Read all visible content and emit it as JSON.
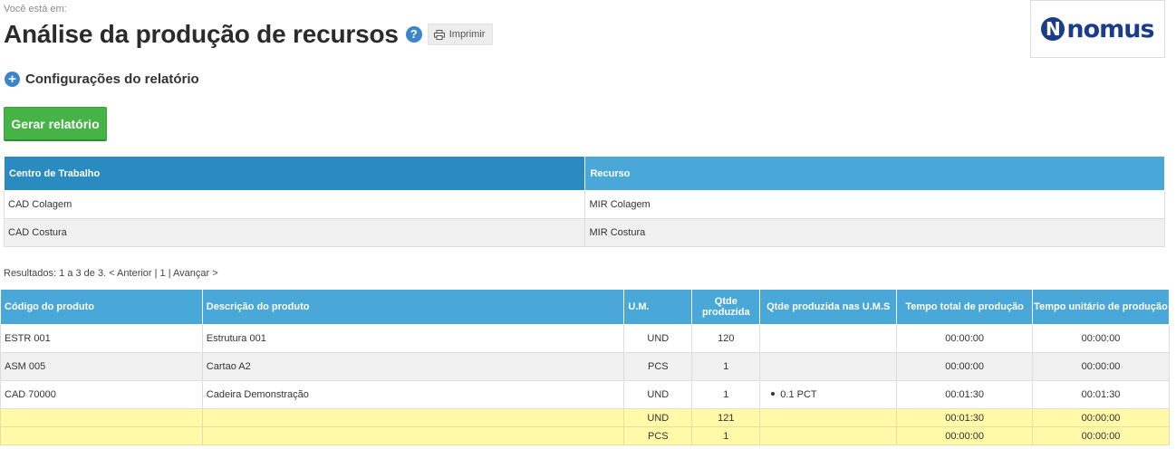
{
  "breadcrumb": "Você está em:",
  "title": "Análise da produção de recursos",
  "help_icon": "?",
  "print_label": "Imprimir",
  "logo": {
    "mark": "N",
    "text": "nomus"
  },
  "config_label": "Configurações do relatório",
  "generate_label": "Gerar relatório",
  "colors": {
    "header_blue": "#4aa8d8",
    "header_dark_blue": "#2a8bc0",
    "green_button": "#45b345",
    "total_row": "#fff9a8"
  },
  "centers_table": {
    "headers": [
      "Centro de Trabalho",
      "Recurso"
    ],
    "rows": [
      [
        "CAD Colagem",
        "MIR Colagem"
      ],
      [
        "CAD Costura",
        "MIR Costura"
      ]
    ]
  },
  "results": "Resultados: 1 a 3 de 3. < Anterior | 1 | Avançar >",
  "production_table": {
    "headers": [
      "Código do produto",
      "Descrição do produto",
      "U.M.",
      "Qtde produzida",
      "Qtde produzida nas U.M.S",
      "Tempo total de produção",
      "Tempo unitário de produção"
    ],
    "rows": [
      {
        "code": "ESTR 001",
        "desc": "Estrutura 001",
        "um": "UND",
        "qty": "120",
        "ums": "",
        "total": "00:00:00",
        "unit": "00:00:00"
      },
      {
        "code": "ASM 005",
        "desc": "Cartao A2",
        "um": "PCS",
        "qty": "1",
        "ums": "",
        "total": "00:00:00",
        "unit": "00:00:00"
      },
      {
        "code": "CAD 70000",
        "desc": "Cadeira Demonstração",
        "um": "UND",
        "qty": "1",
        "ums": "0.1 PCT",
        "total": "00:01:30",
        "unit": "00:01:30"
      }
    ],
    "totals": [
      {
        "um": "UND",
        "qty": "121",
        "total": "00:01:30",
        "unit": "00:00:00"
      },
      {
        "um": "PCS",
        "qty": "1",
        "total": "00:00:00",
        "unit": "00:00:00"
      }
    ]
  }
}
